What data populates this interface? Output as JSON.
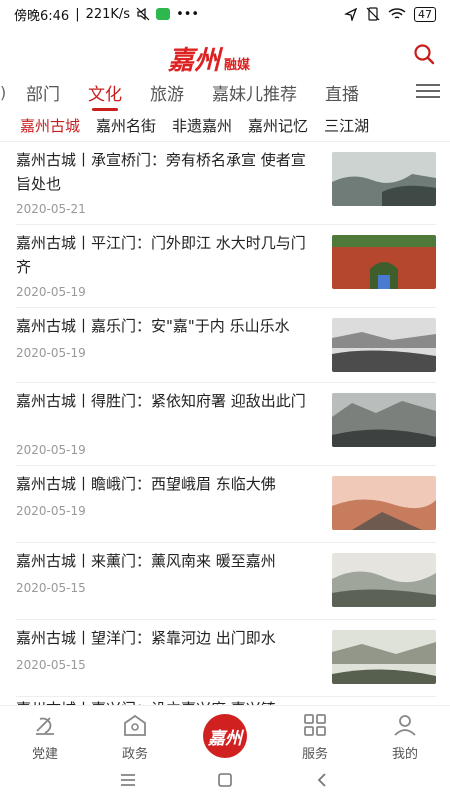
{
  "status": {
    "time": "傍晚6:46",
    "speed": "221K/s",
    "battery": "47"
  },
  "header": {
    "logo_main": "嘉州",
    "logo_sub": "融媒"
  },
  "tabs": [
    "部门",
    "文化",
    "旅游",
    "嘉妹儿推荐",
    "直播"
  ],
  "active_tab": "文化",
  "subtabs": [
    "嘉州古城",
    "嘉州名街",
    "非遗嘉州",
    "嘉州记忆",
    "三江湖"
  ],
  "articles": [
    {
      "title": "嘉州古城丨承宣桥门：旁有桥名承宣 使者宣旨处也",
      "date": "2020-05-21"
    },
    {
      "title": "嘉州古城丨平江门：门外即江 水大时几与门齐",
      "date": "2020-05-19"
    },
    {
      "title": "嘉州古城丨嘉乐门：安\"嘉\"于内 乐山乐水",
      "date": "2020-05-19"
    },
    {
      "title": "嘉州古城丨得胜门：紧依知府署 迎敌出此门",
      "date": "2020-05-19"
    },
    {
      "title": "嘉州古城丨瞻峨门：西望峨眉 东临大佛",
      "date": "2020-05-19"
    },
    {
      "title": "嘉州古城丨来薰门：薰风南来 暖至嘉州",
      "date": "2020-05-15"
    },
    {
      "title": "嘉州古城丨望洋门：紧靠河边 出门即水",
      "date": "2020-05-15"
    },
    {
      "title": "嘉州古城丨嘉兴门：设立嘉兴府 嘉兴镇",
      "date": ""
    }
  ],
  "bottom_nav": [
    {
      "label": "党建",
      "icon": "party-icon"
    },
    {
      "label": "政务",
      "icon": "government-icon"
    },
    {
      "label": "嘉州",
      "icon": "home-logo"
    },
    {
      "label": "服务",
      "icon": "grid-icon"
    },
    {
      "label": "我的",
      "icon": "profile-icon"
    }
  ],
  "colors": {
    "accent": "#c81e1e",
    "logo": "#d02020"
  }
}
